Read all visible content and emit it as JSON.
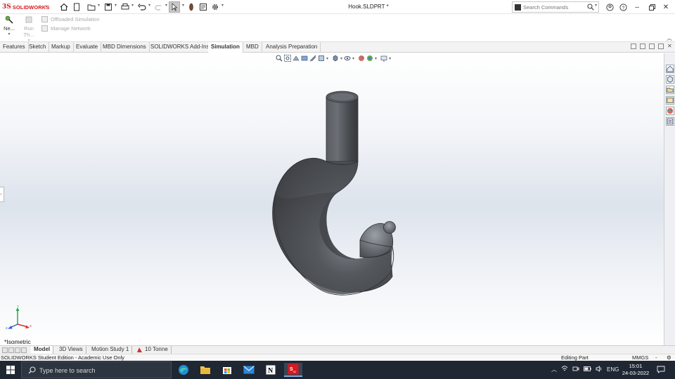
{
  "app": {
    "logo_ds": "3S",
    "logo_text": "SOLIDWORKS",
    "document_title": "Hook.SLDPRT *"
  },
  "search": {
    "placeholder": "Search Commands"
  },
  "command_manager": {
    "new_study_label": "Ne...",
    "run_label": "Run Th...",
    "offloaded_label": "Offloaded Simulation",
    "manage_network_label": "Manage Network"
  },
  "tabs": [
    {
      "label": "Features"
    },
    {
      "label": "Sketch"
    },
    {
      "label": "Markup"
    },
    {
      "label": "Evaluate"
    },
    {
      "label": "MBD Dimensions"
    },
    {
      "label": "SOLIDWORKS Add-Ins"
    },
    {
      "label": "Simulation",
      "active": true
    },
    {
      "label": "MBD"
    },
    {
      "label": "Analysis Preparation"
    }
  ],
  "viewport": {
    "view_name": "*Isometric",
    "model_color": "#4a4d52"
  },
  "bottom_tabs": [
    {
      "label": "Model",
      "active": true
    },
    {
      "label": "3D Views"
    },
    {
      "label": "Motion Study 1"
    },
    {
      "label": "10 Tonne"
    }
  ],
  "status": {
    "left": "SOLIDWORKS Student Edition - Academic Use Only",
    "mode": "Editing Part",
    "units": "MMGS"
  },
  "taskbar": {
    "search_placeholder": "Type here to search",
    "language": "ENG",
    "time": "15:01",
    "date": "24-03-2022"
  },
  "colors": {
    "brand": "#d71920",
    "taskbar_bg": "#1f2733",
    "accent": "#2f6fd6"
  }
}
